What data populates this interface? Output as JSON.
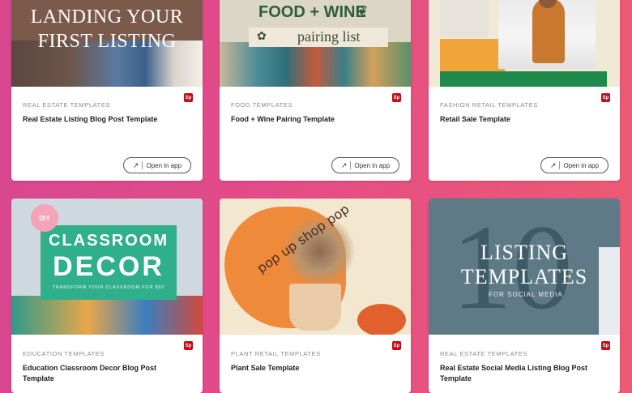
{
  "brand": {
    "badge_text": "Sp",
    "badge_color": "#c40a14",
    "open_icon": "open-in-app-icon"
  },
  "cards": [
    {
      "category": "REAL ESTATE TEMPLATES",
      "title": "Real Estate Listing Blog Post Template",
      "open_label": "Open in app",
      "image": {
        "line1": "LANDING YOUR",
        "line2": "FIRST LISTING"
      }
    },
    {
      "category": "FOOD TEMPLATES",
      "title": "Food + Wine Pairing Template",
      "open_label": "Open in app",
      "image": {
        "line1": "FOOD + WINE",
        "line2": "pairing list"
      }
    },
    {
      "category": "FASHION RETAIL TEMPLATES",
      "title": "Retail Sale Template",
      "open_label": "Open in app",
      "image": {
        "line1": ""
      }
    },
    {
      "category": "EDUCATION TEMPLATES",
      "title": "Education Classroom Decor Blog Post Template",
      "image": {
        "badge": "DIY",
        "line1": "CLASSROOM",
        "line2": "DECOR",
        "line3": "TRANSFORM YOUR CLASSROOM FOR $50"
      }
    },
    {
      "category": "PLANT RETAIL TEMPLATES",
      "title": "Plant Sale Template",
      "image": {
        "line1": "pop up shop pop"
      }
    },
    {
      "category": "REAL ESTATE TEMPLATES",
      "title": "Real Estate Social Media Listing Blog Post Template",
      "image": {
        "number": "10",
        "line1": "LISTING",
        "line2": "TEMPLATES",
        "line3": "FOR SOCIAL MEDIA"
      }
    }
  ]
}
